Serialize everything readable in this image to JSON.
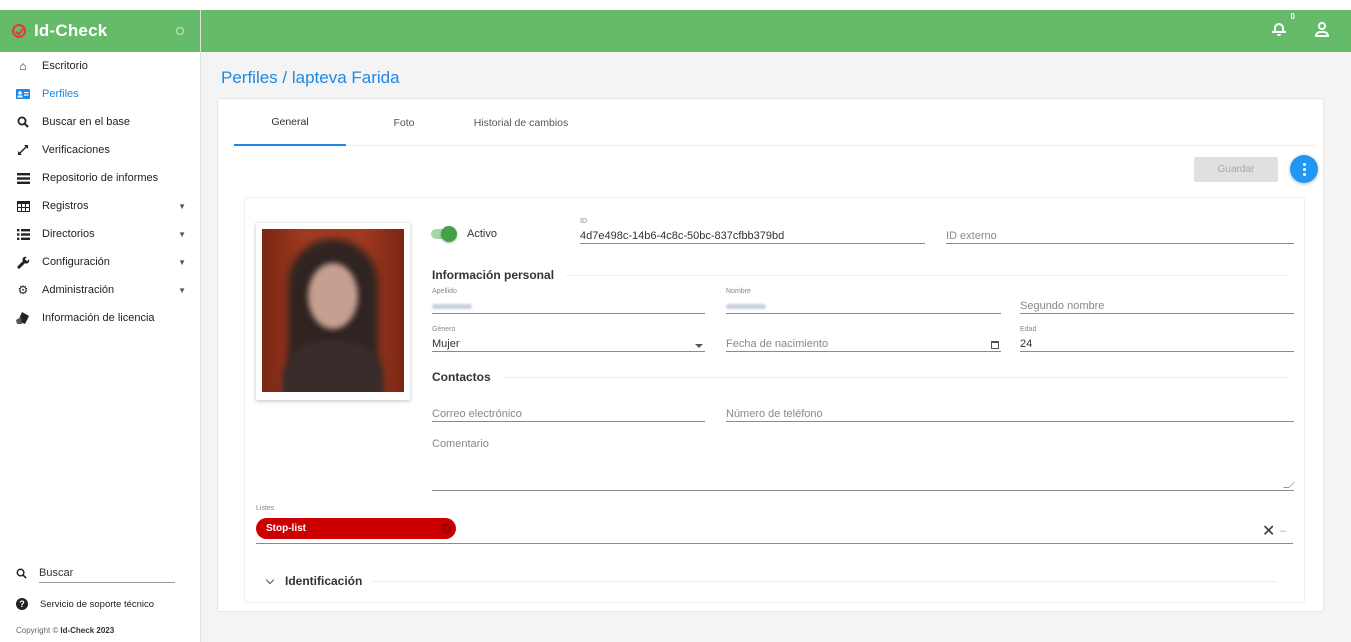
{
  "app": {
    "name": "Id-Check"
  },
  "topbar": {
    "notifications_count": "0"
  },
  "sidebar": {
    "items": [
      {
        "label": "Escritorio",
        "icon": "home-icon"
      },
      {
        "label": "Perfiles",
        "icon": "id-card-icon",
        "active": true
      },
      {
        "label": "Buscar en el base",
        "icon": "search-icon"
      },
      {
        "label": "Verificaciones",
        "icon": "expand-icon"
      },
      {
        "label": "Repositorio de informes",
        "icon": "list-icon"
      },
      {
        "label": "Registros",
        "icon": "table-icon",
        "expandable": true
      },
      {
        "label": "Directorios",
        "icon": "bullet-list-icon",
        "expandable": true
      },
      {
        "label": "Configuración",
        "icon": "wrench-icon",
        "expandable": true
      },
      {
        "label": "Administración",
        "icon": "gear-icon",
        "expandable": true
      },
      {
        "label": "Información de licencia",
        "icon": "license-icon"
      }
    ],
    "search_placeholder": "Buscar",
    "support_label": "Servicio de soporte técnico",
    "copyright_prefix": "Copyright ©",
    "copyright_brand": "Id-Check 2023"
  },
  "page": {
    "title": "Perfiles / lapteva Farida"
  },
  "tabs": [
    {
      "label": "General",
      "active": true
    },
    {
      "label": "Foto"
    },
    {
      "label": "Historial de cambios"
    }
  ],
  "toolbar": {
    "save_label": "Guardar"
  },
  "profile": {
    "active_label": "Activo",
    "id_label": "ID",
    "id_value": "4d7e498c-14b6-4c8c-50bc-837cfbb379bd",
    "external_id_placeholder": "ID externo",
    "personal_section": "Información personal",
    "surname_label": "Apellido",
    "name_label": "Nombre",
    "middle_name_placeholder": "Segundo nombre",
    "gender_label": "Género",
    "gender_value": "Mujer",
    "birthdate_placeholder": "Fecha de nacimiento",
    "age_label": "Edad",
    "age_value": "24",
    "contacts_section": "Contactos",
    "email_placeholder": "Correo electrónico",
    "phone_placeholder": "Número de teléfono",
    "comment_placeholder": "Comentario",
    "lists_label": "Listes",
    "list_chip": "Stop-list",
    "identification_section": "Identificación"
  },
  "colors": {
    "brand_green": "#66bb6a",
    "accent_blue": "#1e88e5",
    "chip_red": "#cc0000"
  }
}
